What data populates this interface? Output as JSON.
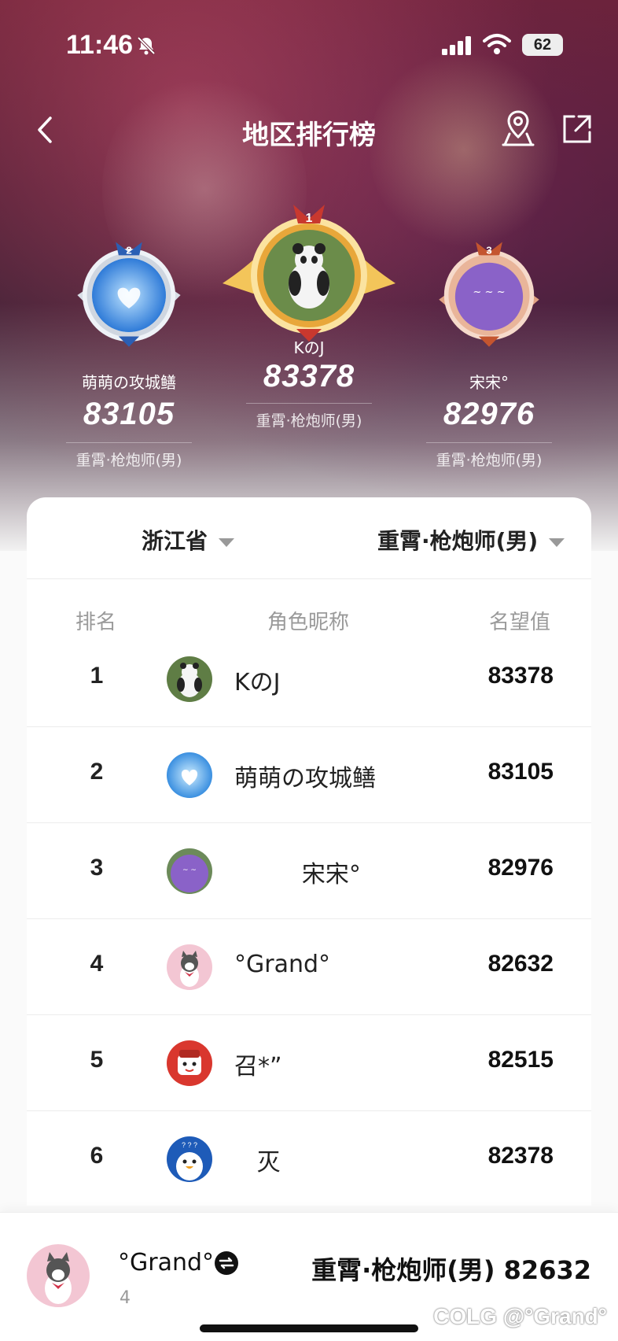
{
  "status_bar": {
    "time": "11:46",
    "battery": "62"
  },
  "nav": {
    "title": "地区排行榜"
  },
  "podium": [
    {
      "rank": "2",
      "name": "萌萌の攻城鳝",
      "score": "83105",
      "job": "重霄·枪炮师(男)"
    },
    {
      "rank": "1",
      "name": "KのJ",
      "score": "83378",
      "job": "重霄·枪炮师(男)"
    },
    {
      "rank": "3",
      "name": "宋宋°",
      "score": "82976",
      "job": "重霄·枪炮师(男)"
    }
  ],
  "filters": {
    "region": "浙江省",
    "job": "重霄·枪炮师(男)"
  },
  "table": {
    "headers": {
      "rank": "排名",
      "name": "角色昵称",
      "value": "名望值"
    },
    "rows": [
      {
        "rank": "1",
        "name": "KのJ",
        "value": "83378",
        "avatar": "panda"
      },
      {
        "rank": "2",
        "name": "萌萌の攻城鳝",
        "value": "83105",
        "avatar": "blue-heart"
      },
      {
        "rank": "3",
        "name": "         宋宋°",
        "value": "82976",
        "avatar": "purple"
      },
      {
        "rank": "4",
        "name": "°Grand°",
        "value": "82632",
        "avatar": "cat"
      },
      {
        "rank": "5",
        "name": "召*”",
        "value": "82515",
        "avatar": "red-face"
      },
      {
        "rank": "6",
        "name": "   灭",
        "value": "82378",
        "avatar": "penguin"
      }
    ]
  },
  "me": {
    "name": "°Grand°",
    "rank": "4",
    "info": "重霄·枪炮师(男) 82632"
  },
  "watermark": "COLG @°Grand°"
}
